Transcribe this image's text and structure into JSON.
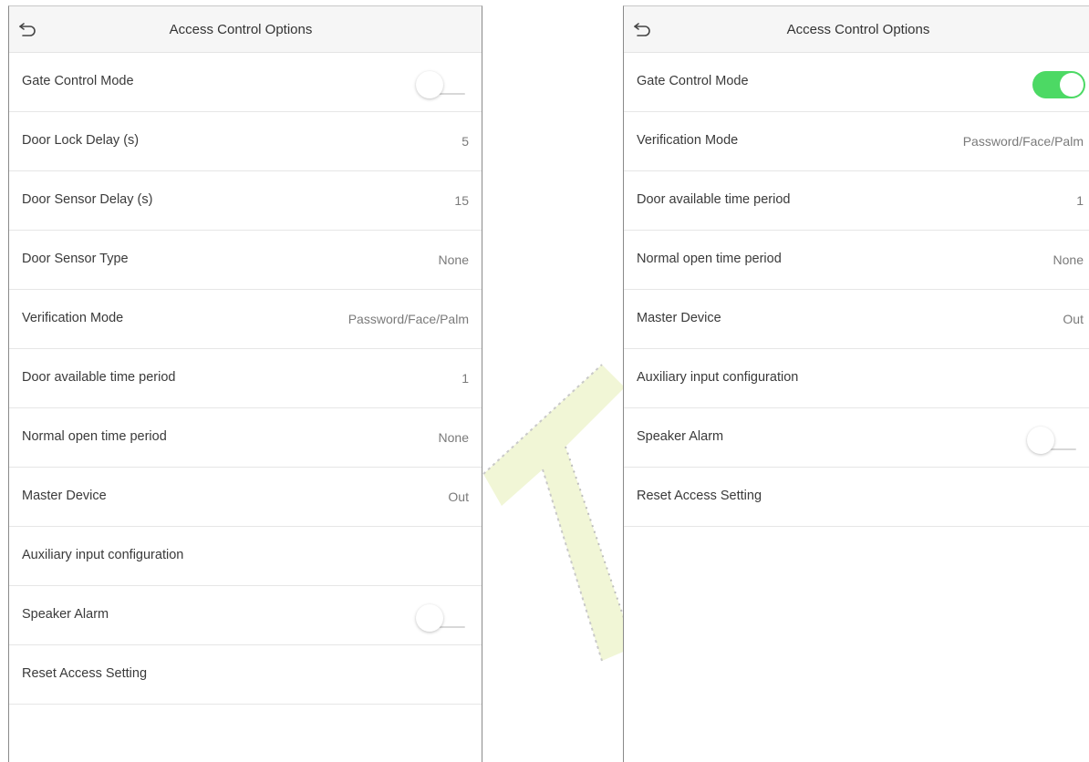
{
  "left_screen": {
    "title": "Access Control Options",
    "rows": [
      {
        "label": "Gate Control Mode",
        "toggle": "off"
      },
      {
        "label": "Door Lock Delay (s)",
        "value": "5"
      },
      {
        "label": "Door Sensor Delay (s)",
        "value": "15"
      },
      {
        "label": "Door Sensor Type",
        "value": "None"
      },
      {
        "label": "Verification Mode",
        "value": "Password/Face/Palm"
      },
      {
        "label": "Door available time period",
        "value": "1"
      },
      {
        "label": "Normal open time period",
        "value": "None"
      },
      {
        "label": "Master Device",
        "value": "Out"
      },
      {
        "label": "Auxiliary input configuration"
      },
      {
        "label": "Speaker Alarm",
        "toggle": "off"
      },
      {
        "label": "Reset Access Setting"
      }
    ]
  },
  "right_screen": {
    "title": "Access Control Options",
    "rows": [
      {
        "label": "Gate Control Mode",
        "toggle": "on"
      },
      {
        "label": "Verification Mode",
        "value": "Password/Face/Palm"
      },
      {
        "label": "Door available time period",
        "value": "1"
      },
      {
        "label": "Normal open time period",
        "value": "None"
      },
      {
        "label": "Master Device",
        "value": "Out"
      },
      {
        "label": "Auxiliary input configuration"
      },
      {
        "label": "Speaker Alarm",
        "toggle": "off"
      },
      {
        "label": "Reset Access Setting"
      }
    ]
  },
  "colors": {
    "toggle_on": "#4cd964",
    "watermark": "#e8f2c0"
  },
  "icons": {
    "back": "back-arrow-icon"
  }
}
